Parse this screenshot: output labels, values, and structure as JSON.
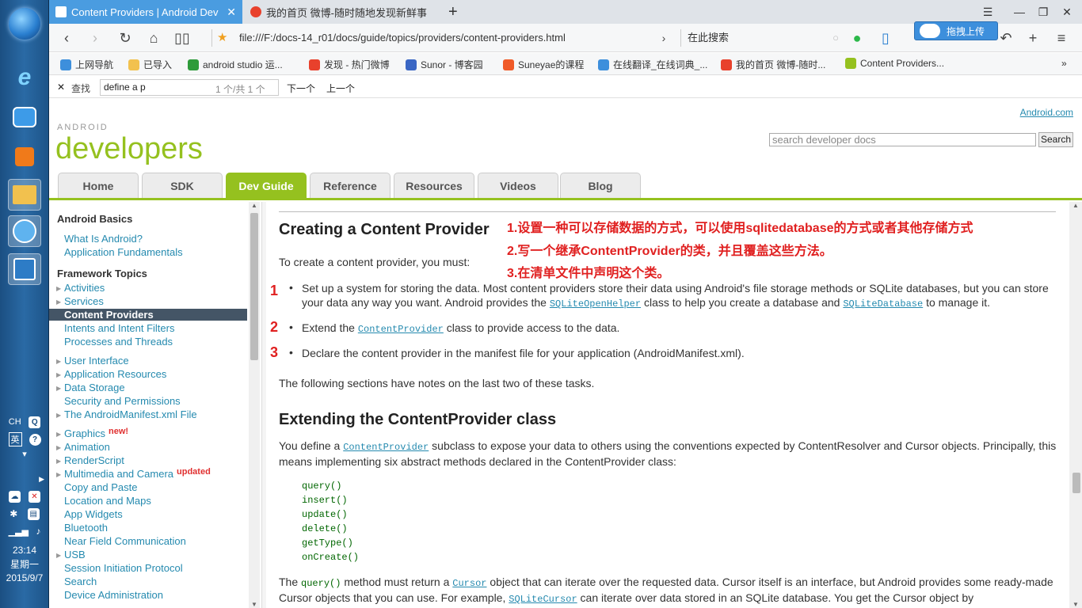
{
  "taskbar": {
    "clock": "23:14",
    "weekday": "星期一",
    "date": "2015/9/7",
    "ime_lang": "CH",
    "ime_mode": "英"
  },
  "tabs": [
    {
      "title": "Content Providers | Android Dev"
    },
    {
      "title": "我的首页 微博-随时随地发现新鲜事"
    }
  ],
  "toolbar": {
    "url": "file:///F:/docs-14_r01/docs/guide/topics/providers/content-providers.html",
    "search_placeholder": "在此搜索",
    "upload_label": "拖拽上传"
  },
  "bookmarks": [
    {
      "label": "上网导航",
      "color": "#3d8fdc"
    },
    {
      "label": "已导入",
      "color": "#f2c14e"
    },
    {
      "label": "android studio 运...",
      "color": "#2e9b3a"
    },
    {
      "label": "发现 - 热门微博",
      "color": "#e8412c"
    },
    {
      "label": "Sunor - 博客园",
      "color": "#3a66c4"
    },
    {
      "label": "Suneyae的课程",
      "color": "#f05a28"
    },
    {
      "label": "在线翻译_在线词典_...",
      "color": "#3d8fdc"
    },
    {
      "label": "我的首页 微博-随时...",
      "color": "#e8412c"
    },
    {
      "label": "Content Providers...",
      "color": "#95c11f"
    }
  ],
  "findbar": {
    "label": "查找",
    "query": "define a p",
    "count": "1 个/共 1 个",
    "next": "下一个",
    "prev": "上一个"
  },
  "site": {
    "android_link": "Android.com",
    "logo_small": "ANDROID",
    "logo": "developers",
    "search_placeholder": "search developer docs",
    "search_button": "Search",
    "nav": [
      "Home",
      "SDK",
      "Dev Guide",
      "Reference",
      "Resources",
      "Videos",
      "Blog"
    ]
  },
  "sidebar": {
    "basics_heading": "Android Basics",
    "basics": [
      "What Is Android?",
      "Application Fundamentals"
    ],
    "framework_heading": "Framework Topics",
    "items": [
      {
        "label": "Activities"
      },
      {
        "label": "Services"
      },
      {
        "label": "Content Providers"
      },
      {
        "label": "Intents and Intent Filters"
      },
      {
        "label": "Processes and Threads"
      },
      {
        "label": "User Interface"
      },
      {
        "label": "Application Resources"
      },
      {
        "label": "Data Storage"
      },
      {
        "label": "Security and Permissions"
      },
      {
        "label": "The AndroidManifest.xml File"
      },
      {
        "label": "Graphics",
        "badge": "new!"
      },
      {
        "label": "Animation"
      },
      {
        "label": "RenderScript"
      },
      {
        "label": "Multimedia and Camera",
        "badge": "updated"
      },
      {
        "label": "Copy and Paste"
      },
      {
        "label": "Location and Maps"
      },
      {
        "label": "App Widgets"
      },
      {
        "label": "Bluetooth"
      },
      {
        "label": "Near Field Communication"
      },
      {
        "label": "USB"
      },
      {
        "label": "Session Initiation Protocol"
      },
      {
        "label": "Search"
      },
      {
        "label": "Device Administration"
      }
    ]
  },
  "content": {
    "h1": "Creating a Content Provider",
    "notes": [
      "1.设置一种可以存储数据的方式，可以使用sqlitedatabase的方式或者其他存储方式",
      "2.写一个继承ContentProvider的类，并且覆盖这些方法。",
      "3.在清单文件中声明这个类。"
    ],
    "intro": "To create a content provider, you must:",
    "step_numbers": [
      "1",
      "2",
      "3"
    ],
    "step1_a": "Set up a system for storing the data. Most content providers store their data using Android's file storage methods or SQLite databases, but you can store your data any way you want. Android provides the ",
    "step1_link1": "SQLiteOpenHelper",
    "step1_b": " class to help you create a database and ",
    "step1_link2": "SQLiteDatabase",
    "step1_c": " to manage it.",
    "step2_a": "Extend the ",
    "step2_link": "ContentProvider",
    "step2_b": " class to provide access to the data.",
    "step3": "Declare the content provider in the manifest file for your application (AndroidManifest.xml).",
    "following": "The following sections have notes on the last two of these tasks.",
    "h2": "Extending the ContentProvider class",
    "def_a": "You define a ",
    "def_link": "ContentProvider",
    "def_b": " subclass to expose your data to others using the conventions expected by ContentResolver and Cursor objects. Principally, this means implementing six abstract methods declared in the ContentProvider class:",
    "methods": [
      "query()",
      "insert()",
      "update()",
      "delete()",
      "getType()",
      "onCreate()"
    ],
    "q_a": "The ",
    "q_code": "query()",
    "q_b": " method must return a ",
    "q_link1": "Cursor",
    "q_c": " object that can iterate over the requested data. Cursor itself is an interface, but Android provides some ready-made Cursor objects that you can use. For example, ",
    "q_link2": "SQLiteCursor",
    "q_d": " can iterate over data stored in an SQLite database. You get the Cursor object by"
  }
}
